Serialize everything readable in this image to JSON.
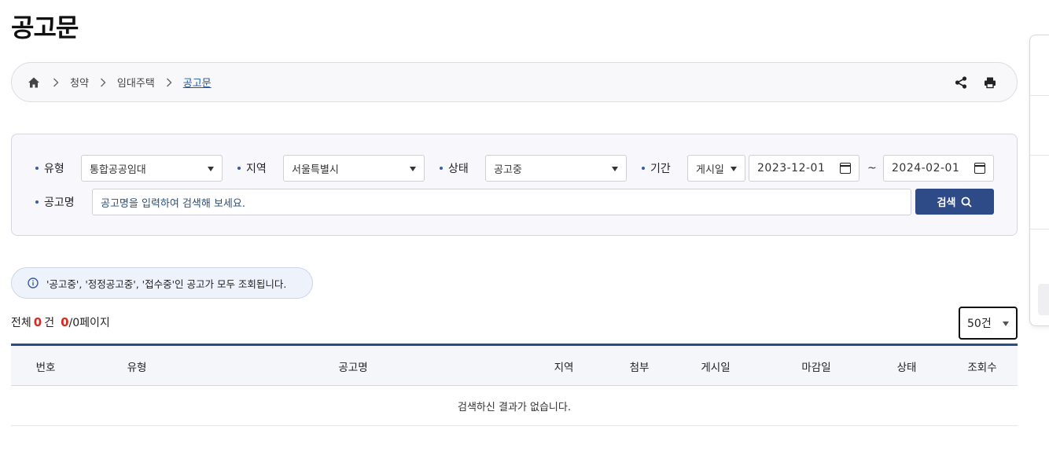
{
  "page": {
    "title": "공고문"
  },
  "breadcrumb": {
    "home_icon": "home-icon",
    "items": [
      "청약",
      "임대주택",
      "공고문"
    ]
  },
  "actions": {
    "share_icon": "share-icon",
    "print_icon": "print-icon"
  },
  "search": {
    "type_label": "유형",
    "type_value": "통합공공임대",
    "region_label": "지역",
    "region_value": "서울특별시",
    "status_label": "상태",
    "status_value": "공고중",
    "period_label": "기간",
    "period_type_value": "게시일",
    "date_from": "2023-12-01",
    "date_separator": "~",
    "date_to": "2024-02-01",
    "keyword_label": "공고명",
    "keyword_placeholder": "공고명을 입력하여 검색해 보세요.",
    "button_label": "검색"
  },
  "notice": {
    "icon": "info-icon",
    "text": "'공고중', '정정공고중', '접수중'인 공고가 모두 조회됩니다."
  },
  "summary": {
    "total_prefix": "전체",
    "total_count": "0",
    "total_suffix": "건",
    "page_current": "0",
    "page_suffix": "/0페이지"
  },
  "per_page": {
    "value": "50건"
  },
  "table": {
    "columns": [
      "번호",
      "유형",
      "공고명",
      "지역",
      "첨부",
      "게시일",
      "마감일",
      "상태",
      "조회수"
    ],
    "empty_message": "검색하신 결과가 없습니다."
  },
  "colors": {
    "accent": "#2e4a87",
    "count_red": "#d32b20",
    "link_blue": "#1a56a8"
  }
}
